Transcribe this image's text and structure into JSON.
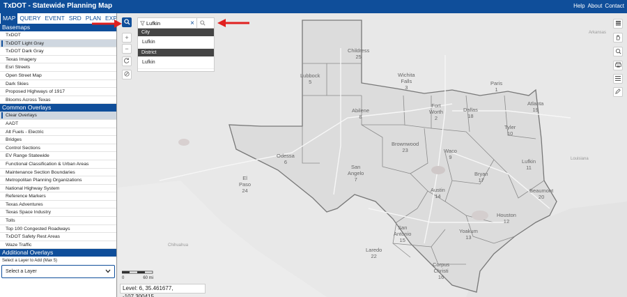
{
  "header": {
    "title": "TxDOT - Statewide Planning Map",
    "links": [
      "Help",
      "About",
      "Contact"
    ]
  },
  "tabs": [
    "MAP",
    "QUERY",
    "EVENT",
    "SRD",
    "PLAN",
    "EXPLORE"
  ],
  "basemaps": {
    "title": "Basemaps",
    "items": [
      "TxDOT",
      "TxDOT Light Gray",
      "TxDOT Dark Gray",
      "Texas Imagery",
      "Esri Streets",
      "Open Street Map",
      "Dark Skies",
      "Proposed Highways of 1917",
      "Blooms Across Texas"
    ]
  },
  "common_overlays": {
    "title": "Common Overlays",
    "items": [
      "Clear Overlays",
      "AADT",
      "Alt Fuels - Electric",
      "Bridges",
      "Control Sections",
      "EV Range Statewide",
      "Functional Classification & Urban Areas",
      "Maintenance Section Boundaries",
      "Metropolitan Planning Organizations",
      "National Highway System",
      "Reference Markers",
      "Texas Adventures",
      "Texas Space Industry",
      "Tolls",
      "Top 100 Congested Roadways",
      "TxDOT Safety Rest Areas",
      "Waze Traffic"
    ]
  },
  "additional_overlays": {
    "title": "Additional Overlays",
    "hint": "Select a Layer to Add (Max 5)",
    "select_value": "Select a Layer"
  },
  "search": {
    "value": "Lufkin",
    "city_header": "City",
    "city_result": "Lufkin",
    "district_header": "District",
    "district_result": "Lufkin"
  },
  "map": {
    "districts": [
      {
        "name": "Childress",
        "num": "25"
      },
      {
        "name": "Lubbock",
        "num": "5"
      },
      {
        "name": "Wichita\nFalls",
        "num": "3"
      },
      {
        "name": "Paris",
        "num": "1"
      },
      {
        "name": "Fort\nWorth",
        "num": "2"
      },
      {
        "name": "Dallas",
        "num": "18"
      },
      {
        "name": "Atlanta",
        "num": "19"
      },
      {
        "name": "Abilene",
        "num": "8"
      },
      {
        "name": "Tyler",
        "num": "10"
      },
      {
        "name": "Odessa",
        "num": "6"
      },
      {
        "name": "Brownwood",
        "num": "23"
      },
      {
        "name": "Waco",
        "num": "9"
      },
      {
        "name": "Lufkin",
        "num": "11"
      },
      {
        "name": "El\nPaso",
        "num": "24"
      },
      {
        "name": "San\nAngelo",
        "num": "7"
      },
      {
        "name": "Bryan",
        "num": "17"
      },
      {
        "name": "Austin",
        "num": "14"
      },
      {
        "name": "Beaumont",
        "num": "20"
      },
      {
        "name": "Houston",
        "num": "12"
      },
      {
        "name": "San\nAntonio",
        "num": "15"
      },
      {
        "name": "Yoakum",
        "num": "13"
      },
      {
        "name": "Laredo",
        "num": "22"
      },
      {
        "name": "Corpus\nChristi",
        "num": "16"
      }
    ],
    "state_labels": [
      "Arkansas",
      "Louisiana",
      "Chihuahua"
    ],
    "scale_value": "60 mi",
    "status": "Level: 6, 35.461677, -107.300415"
  },
  "colors": {
    "brand": "#0f4e9a",
    "annotation_arrow": "#e0201f"
  }
}
